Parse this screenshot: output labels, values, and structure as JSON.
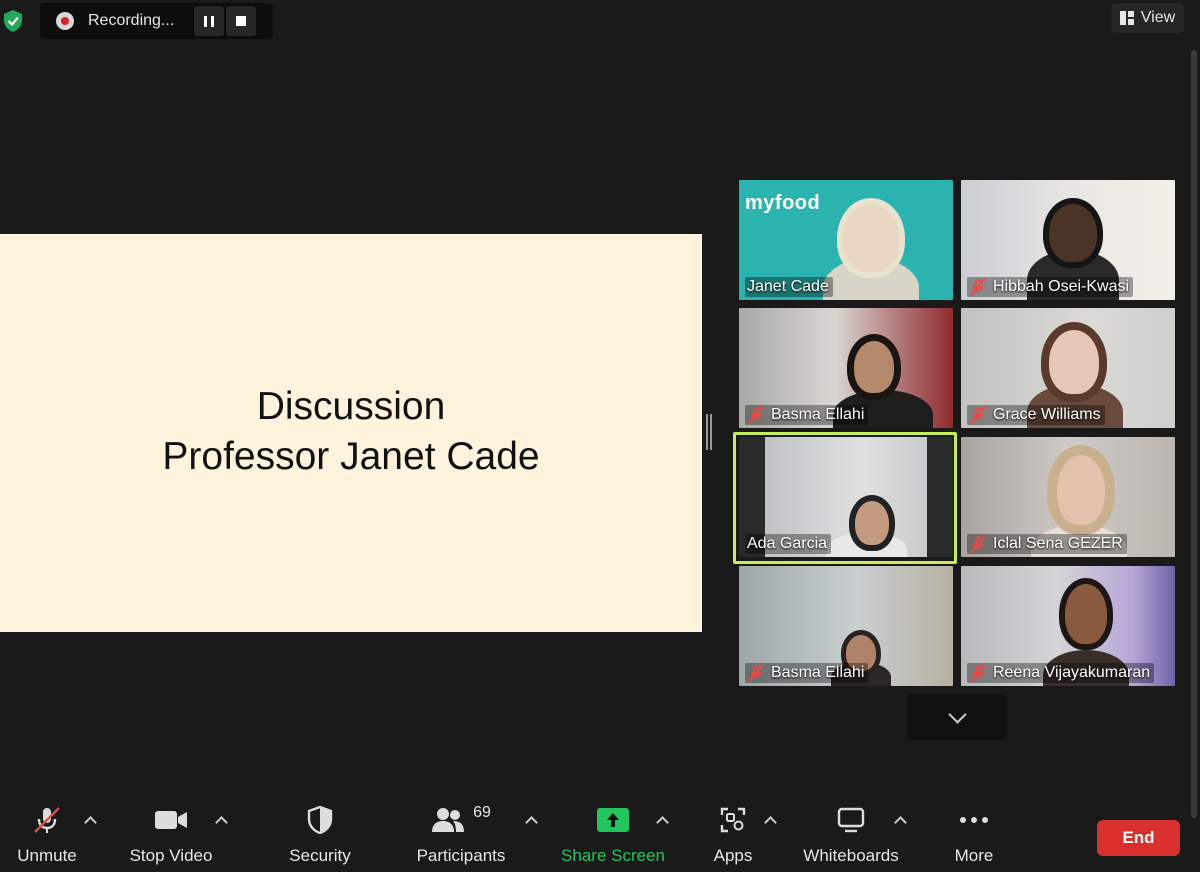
{
  "recording": {
    "label": "Recording..."
  },
  "view": {
    "label": "View"
  },
  "slide": {
    "line1": "Discussion",
    "line2": "Professor Janet Cade"
  },
  "tiles": [
    {
      "name": "Janet Cade",
      "muted": false,
      "logo": "myfood"
    },
    {
      "name": "Hibbah Osei-Kwasi",
      "muted": true
    },
    {
      "name": "Basma Ellahi",
      "muted": true
    },
    {
      "name": "Grace Williams",
      "muted": true
    },
    {
      "name": "Ada Garcia",
      "muted": false
    },
    {
      "name": "Iclal Sena GEZER",
      "muted": true
    },
    {
      "name": "Basma Ellahi",
      "muted": true
    },
    {
      "name": "Reena Vijayakumaran",
      "muted": true
    }
  ],
  "toolbar": {
    "unmute": "Unmute",
    "stop_video": "Stop Video",
    "security": "Security",
    "participants": "Participants",
    "participant_count": "69",
    "share_screen": "Share Screen",
    "apps": "Apps",
    "whiteboards": "Whiteboards",
    "more": "More",
    "end": "End"
  },
  "colors": {
    "share_green": "#22c55e",
    "end_red": "#d9302e",
    "active_border": "#c8ec5a",
    "slide_bg": "#fff3de"
  }
}
